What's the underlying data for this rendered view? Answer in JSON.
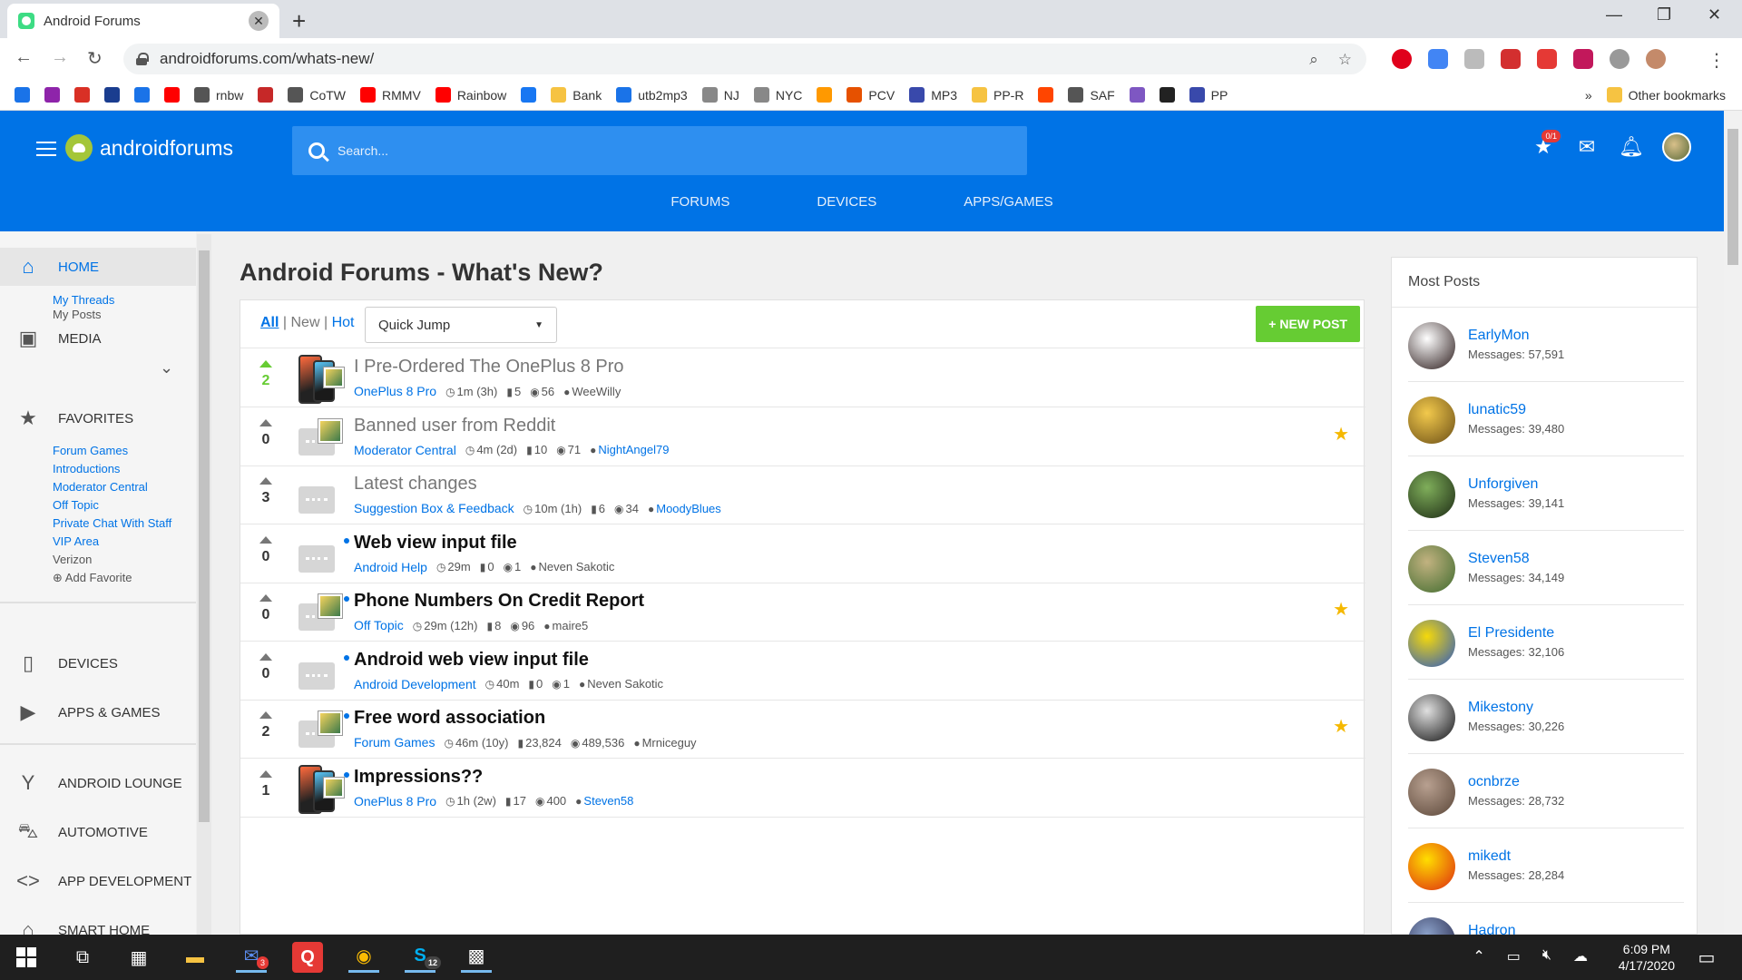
{
  "browser": {
    "tab_title": "Android Forums",
    "url": "androidforums.com/whats-new/",
    "bookmarks": [
      {
        "label": "",
        "color": "#1a73e8"
      },
      {
        "label": "",
        "color": "#8e24aa"
      },
      {
        "label": "",
        "color": "#d93025"
      },
      {
        "label": "",
        "color": "#1a3d8f"
      },
      {
        "label": "",
        "color": "#1a73e8"
      },
      {
        "label": "",
        "color": "#ff0000"
      },
      {
        "label": "rnbw",
        "color": "#555555"
      },
      {
        "label": "",
        "color": "#c62828"
      },
      {
        "label": "CoTW",
        "color": "#555555"
      },
      {
        "label": "RMMV",
        "color": "#ff0000"
      },
      {
        "label": "Rainbow",
        "color": "#ff0000"
      },
      {
        "label": "",
        "color": "#1877f2"
      },
      {
        "label": "Bank",
        "color": "#f6c342"
      },
      {
        "label": "utb2mp3",
        "color": "#1a73e8"
      },
      {
        "label": "NJ",
        "color": "#888888"
      },
      {
        "label": "NYC",
        "color": "#888888"
      },
      {
        "label": "",
        "color": "#ff9900"
      },
      {
        "label": "PCV",
        "color": "#e65100"
      },
      {
        "label": "MP3",
        "color": "#3949ab"
      },
      {
        "label": "PP-R",
        "color": "#f6c342"
      },
      {
        "label": "",
        "color": "#ff4500"
      },
      {
        "label": "SAF",
        "color": "#555555"
      },
      {
        "label": "",
        "color": "#7e57c2"
      },
      {
        "label": "",
        "color": "#222222"
      },
      {
        "label": "PP",
        "color": "#3949ab"
      }
    ],
    "bookmarks_overflow": "»",
    "other_bookmarks": "Other bookmarks"
  },
  "header": {
    "logo_text": "androidforums",
    "search_placeholder": "Search...",
    "alerts_badge": "0/1",
    "nav": [
      "FORUMS",
      "DEVICES",
      "APPS/GAMES"
    ]
  },
  "sidebar": {
    "home": "HOME",
    "home_links": [
      "My Threads",
      "My Posts"
    ],
    "media": "MEDIA",
    "favorites": "FAVORITES",
    "favorite_links": [
      "Forum Games",
      "Introductions",
      "Moderator Central",
      "Off Topic",
      "Private Chat With Staff",
      "VIP Area"
    ],
    "favorite_plain": "Verizon",
    "add_favorite": "⊕ Add Favorite",
    "devices": "DEVICES",
    "apps_games": "APPS & GAMES",
    "android_lounge": "ANDROID LOUNGE",
    "automotive": "AUTOMOTIVE",
    "app_development": "APP DEVELOPMENT",
    "smart_home": "SMART HOME"
  },
  "main": {
    "title": "Android Forums - What's New?",
    "filter_all": "All",
    "filter_new": "New",
    "filter_hot": "Hot",
    "quick_jump": "Quick Jump",
    "new_post": "+ NEW POST",
    "threads": [
      {
        "votes": "2",
        "title": "I Pre-Ordered The OnePlus 8 Pro",
        "forum": "OnePlus 8 Pro",
        "time": "1m (3h)",
        "replies": "5",
        "views": "56",
        "author": "WeeWilly",
        "unread": false,
        "starred": false,
        "thumb": "phone",
        "vote_green": true,
        "author_blue": false
      },
      {
        "votes": "0",
        "title": "Banned user from Reddit",
        "forum": "Moderator Central",
        "time": "4m (2d)",
        "replies": "10",
        "views": "71",
        "author": "NightAngel79",
        "unread": false,
        "starred": true,
        "thumb": "bubble-img",
        "vote_green": false,
        "author_blue": true
      },
      {
        "votes": "3",
        "title": "Latest changes",
        "forum": "Suggestion Box & Feedback",
        "time": "10m (1h)",
        "replies": "6",
        "views": "34",
        "author": "MoodyBlues",
        "unread": false,
        "starred": false,
        "thumb": "bubble",
        "vote_green": false,
        "author_blue": true
      },
      {
        "votes": "0",
        "title": "Web view input file",
        "forum": "Android Help",
        "time": "29m",
        "replies": "0",
        "views": "1",
        "author": "Neven Sakotic",
        "unread": true,
        "starred": false,
        "thumb": "bubble",
        "vote_green": false,
        "author_blue": false
      },
      {
        "votes": "0",
        "title": "Phone Numbers On Credit Report",
        "forum": "Off Topic",
        "time": "29m (12h)",
        "replies": "8",
        "views": "96",
        "author": "maire5",
        "unread": true,
        "starred": true,
        "thumb": "bubble-img",
        "vote_green": false,
        "author_blue": false
      },
      {
        "votes": "0",
        "title": "Android web view input file",
        "forum": "Android Development",
        "time": "40m",
        "replies": "0",
        "views": "1",
        "author": "Neven Sakotic",
        "unread": true,
        "starred": false,
        "thumb": "bubble",
        "vote_green": false,
        "author_blue": false
      },
      {
        "votes": "2",
        "title": "Free word association",
        "forum": "Forum Games",
        "time": "46m (10y)",
        "replies": "23,824",
        "views": "489,536",
        "author": "Mrniceguy",
        "unread": true,
        "starred": true,
        "thumb": "bubble-img",
        "vote_green": false,
        "author_blue": false
      },
      {
        "votes": "1",
        "title": "Impressions??",
        "forum": "OnePlus 8 Pro",
        "time": "1h (2w)",
        "replies": "17",
        "views": "400",
        "author": "Steven58",
        "unread": true,
        "starred": false,
        "thumb": "phone",
        "vote_green": false,
        "author_blue": true
      }
    ]
  },
  "most_posts": {
    "title": "Most Posts",
    "posters": [
      {
        "name": "EarlyMon",
        "messages": "Messages: 57,591",
        "color1": "#ffffff",
        "color2": "#2a1a1a"
      },
      {
        "name": "lunatic59",
        "messages": "Messages: 39,480",
        "color1": "#f2c94c",
        "color2": "#6b4e16"
      },
      {
        "name": "Unforgiven",
        "messages": "Messages: 39,141",
        "color1": "#7fae5a",
        "color2": "#1c2a14"
      },
      {
        "name": "Steven58",
        "messages": "Messages: 34,149",
        "color1": "#c2b280",
        "color2": "#3f6b2e"
      },
      {
        "name": "El Presidente",
        "messages": "Messages: 32,106",
        "color1": "#f5d90a",
        "color2": "#2b59c3"
      },
      {
        "name": "Mikestony",
        "messages": "Messages: 30,226",
        "color1": "#e0e0e0",
        "color2": "#111111"
      },
      {
        "name": "ocnbrze",
        "messages": "Messages: 28,732",
        "color1": "#b8a090",
        "color2": "#5a4638"
      },
      {
        "name": "mikedt",
        "messages": "Messages: 28,284",
        "color1": "#ffde00",
        "color2": "#de2910"
      },
      {
        "name": "Hadron",
        "messages": "",
        "color1": "#8aa0c8",
        "color2": "#222244"
      }
    ]
  },
  "taskbar": {
    "time": "6:09 PM",
    "date": "4/17/2020",
    "badge_mail": "3",
    "badge_skype": "12"
  }
}
